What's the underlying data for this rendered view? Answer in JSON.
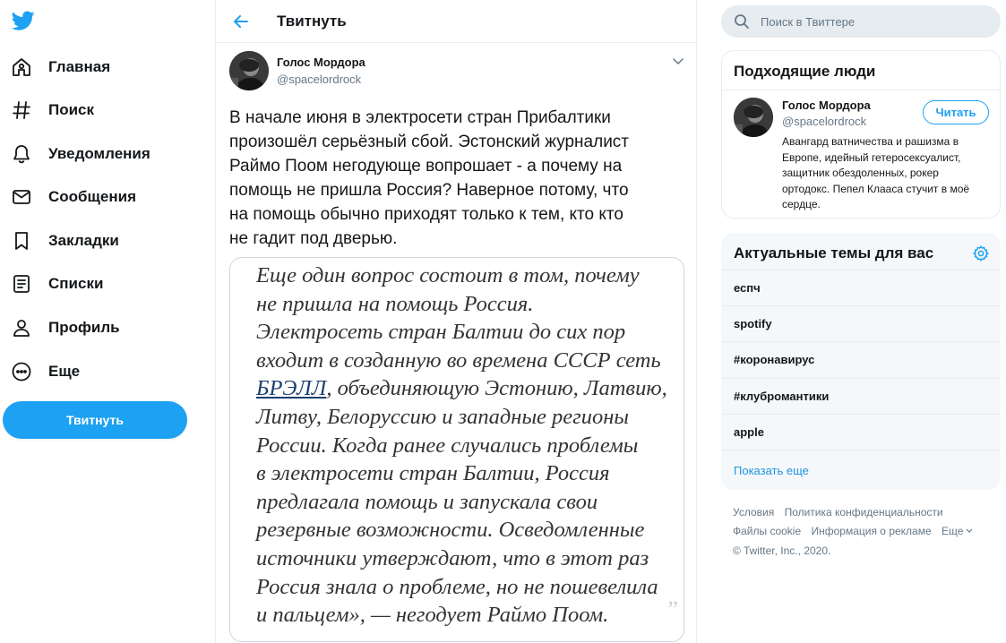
{
  "app": {
    "accent": "#1da1f2"
  },
  "nav": {
    "items": [
      {
        "label": "Главная",
        "icon": "home-icon"
      },
      {
        "label": "Поиск",
        "icon": "hashtag-icon"
      },
      {
        "label": "Уведомления",
        "icon": "bell-icon"
      },
      {
        "label": "Сообщения",
        "icon": "envelope-icon"
      },
      {
        "label": "Закладки",
        "icon": "bookmark-icon"
      },
      {
        "label": "Списки",
        "icon": "list-icon"
      },
      {
        "label": "Профиль",
        "icon": "user-icon"
      },
      {
        "label": "Еще",
        "icon": "more-icon"
      }
    ],
    "tweet_button": "Твитнуть"
  },
  "main": {
    "title": "Твитнуть",
    "tweet": {
      "author_name": "Голос Мордора",
      "author_handle": "@spacelordrock",
      "text": "В начале июня в электросети стран Прибалтики\nпроизошёл серьёзный сбой. Эстонский журналист\nРаймо Поом негодующе вопрошает - а почему на\nпомощь не пришла Россия? Наверное потому, что\nна помощь обычно приходят только к тем, кто кто\nне гадит под дверью.",
      "image_text_before": "Еще один вопрос состоит в том, почему\nне пришла на помощь Россия.\nЭлектросеть стран Балтии до сих пор\nвходит в созданную во времена СССР сеть\n",
      "image_link": "БРЭЛЛ",
      "image_text_after": ", объединяющую Эстонию, Латвию,\nЛитву, Белоруссию и западные регионы\nРоссии. Когда ранее случались проблемы\nв электросети стран Балтии, Россия\nпредлагала помощь и запускала свои\nрезервные возможности. Осведомленные\nисточники утверждают, что в этот раз\nРоссия знала о проблеме, но не пошевелила\nи пальцем», — негодует Раймо Поом."
    }
  },
  "right": {
    "search": {
      "placeholder": "Поиск в Твиттере"
    },
    "who_to_follow": {
      "title": "Подходящие люди",
      "name": "Голос Мордора",
      "handle": "@spacelordrock",
      "follow_label": "Читать",
      "bio": "Авангард ватничества и рашизма в\nЕвропе, идейный гетеросексуалист,\nзащитник обездоленных, рокер\nортодокс. Пепел Клааса стучит в моё\nсердце."
    },
    "trends": {
      "title": "Актуальные темы для вас",
      "items": [
        "еспч",
        "spotify",
        "#коронавирус",
        "#клубромантики",
        "apple"
      ],
      "show_more": "Показать еще"
    },
    "footer": {
      "links_row1": [
        "Условия",
        "Политика конфиденциальности"
      ],
      "links_row2": [
        "Файлы cookie",
        "Информация о рекламе",
        "Еще"
      ],
      "copyright": "© Twitter, Inc., 2020."
    }
  }
}
